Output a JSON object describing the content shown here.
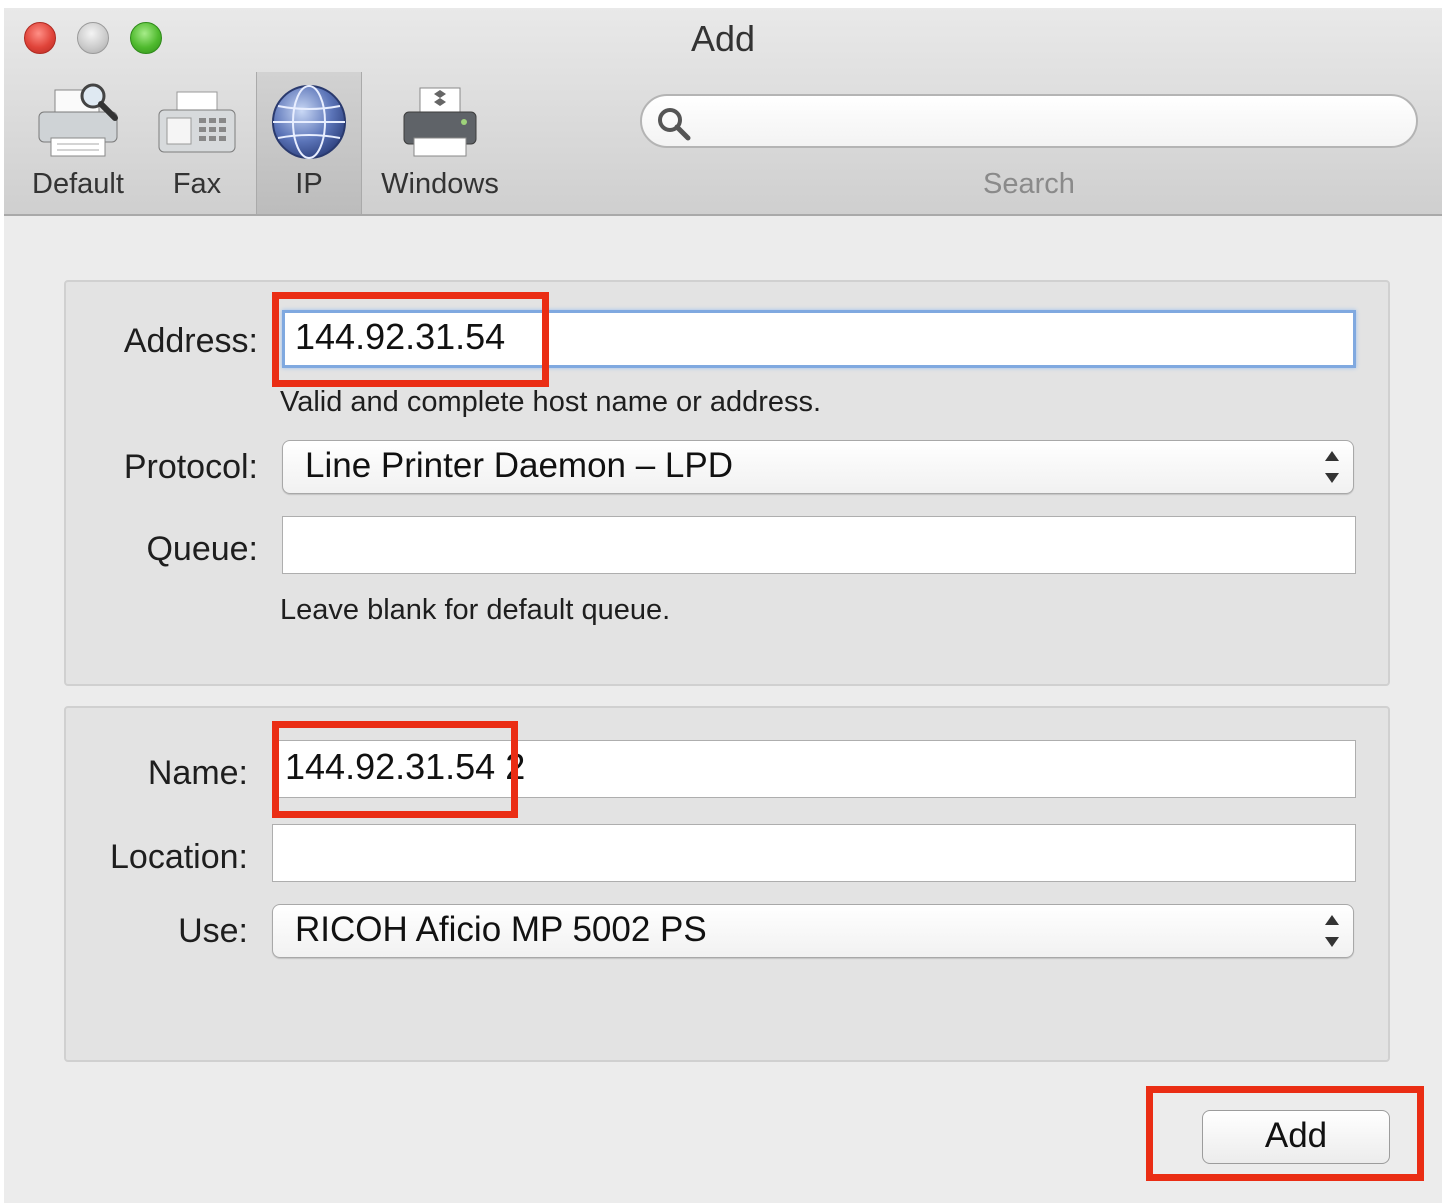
{
  "window": {
    "title": "Add"
  },
  "toolbar": {
    "items": [
      {
        "label": "Default",
        "icon": "default-printer-icon"
      },
      {
        "label": "Fax",
        "icon": "fax-icon"
      },
      {
        "label": "IP",
        "icon": "globe-icon",
        "selected": true
      },
      {
        "label": "Windows",
        "icon": "windows-printer-icon"
      }
    ],
    "search_label": "Search"
  },
  "connection": {
    "address_label": "Address:",
    "address_value": "144.92.31.54",
    "address_hint": "Valid and complete host name or address.",
    "protocol_label": "Protocol:",
    "protocol_value": "Line Printer Daemon – LPD",
    "queue_label": "Queue:",
    "queue_value": "",
    "queue_hint": "Leave blank for default queue."
  },
  "details": {
    "name_label": "Name:",
    "name_value": "144.92.31.54 2",
    "location_label": "Location:",
    "location_value": "",
    "use_label": "Use:",
    "use_value": "RICOH Aficio MP 5002 PS"
  },
  "actions": {
    "add_label": "Add"
  },
  "colors": {
    "highlight": "#ea2d14",
    "focus_ring": "#80a9e0"
  }
}
